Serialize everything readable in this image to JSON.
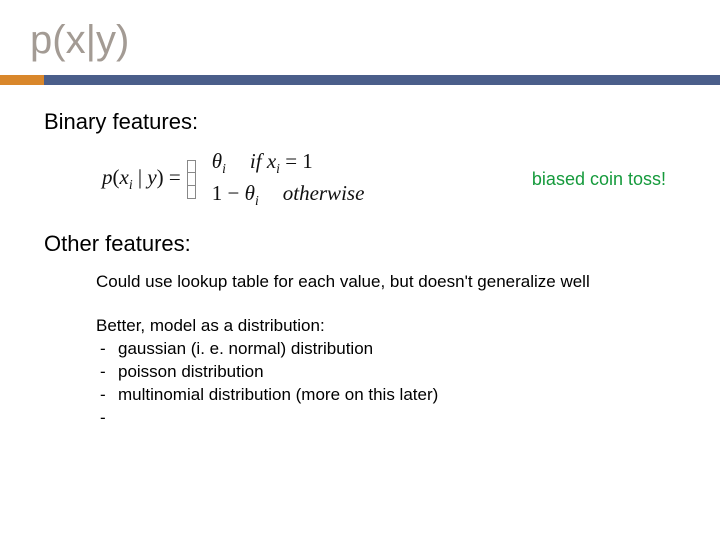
{
  "title": "p(x|y)",
  "section1": {
    "header": "Binary features:",
    "formula": {
      "lhs_prefix": "p",
      "lhs_open": "(",
      "lhs_var": "x",
      "lhs_sub": "i",
      "lhs_mid": " | ",
      "lhs_cond": "y",
      "lhs_close": ")",
      "eq": " = ",
      "case1_val_sym": "θ",
      "case1_val_sub": "i",
      "case1_cond_prefix": "if  ",
      "case1_cond_var": "x",
      "case1_cond_sub": "i",
      "case1_cond_eq": " = ",
      "case1_cond_rhs": "1",
      "case2_prefix": "1 − ",
      "case2_val_sym": "θ",
      "case2_val_sub": "i",
      "case2_cond": "otherwise"
    },
    "callout": "biased coin toss!"
  },
  "section2": {
    "header": "Other features:",
    "p1": "Could use lookup table for each value, but doesn't generalize well",
    "p2": "Better, model as a distribution:",
    "items": {
      "d0": "gaussian (i. e. normal) distribution",
      "d1": "poisson distribution",
      "d2": "multinomial distribution (more on this later)",
      "d3": ""
    }
  }
}
